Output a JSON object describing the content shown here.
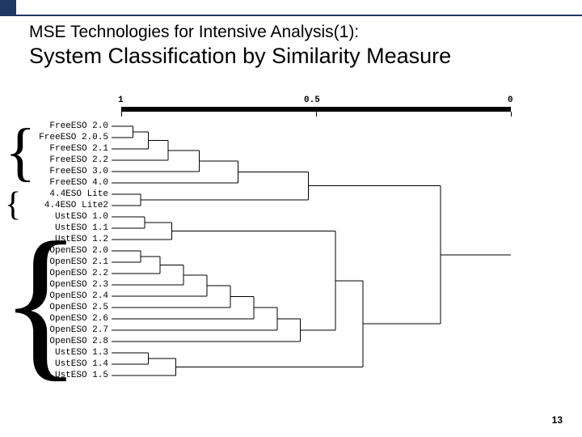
{
  "accent_color": "#1f3864",
  "header": {
    "subtitle": "MSE Technologies for Intensive Analysis(1):",
    "title": "System Classification by Similarity Measure"
  },
  "page_number": "13",
  "dendrogram": {
    "axis_labels": {
      "left": "1",
      "mid": "0.5",
      "right": "0"
    },
    "leaves": [
      "FreeESO 2.0",
      "FreeESO 2.0.5",
      "FreeESO 2.1",
      "FreeESO 2.2",
      "FreeESO 3.0",
      "FreeESO 4.0",
      "4.4ESO Lite",
      "4.4ESO Lite2",
      "UstESO 1.0",
      "UstESO 1.1",
      "UstESO 1.2",
      "OpenESO 2.0",
      "OpenESO 2.1",
      "OpenESO 2.2",
      "OpenESO 2.3",
      "OpenESO 2.4",
      "OpenESO 2.5",
      "OpenESO 2.6",
      "OpenESO 2.7",
      "OpenESO 2.8",
      "UstESO 1.3",
      "UstESO 1.4",
      "UstESO 1.5"
    ]
  },
  "chart_data": {
    "type": "dendrogram",
    "similarity_axis": {
      "left": 1.0,
      "right": 0.0
    },
    "merges": [
      {
        "members": [
          "FreeESO 2.0",
          "FreeESO 2.0.5"
        ],
        "similarity": 0.97
      },
      {
        "members": [
          "(FreeESO 2.0,2.0.5)",
          "FreeESO 2.1"
        ],
        "similarity": 0.93
      },
      {
        "members": [
          "(prev)",
          "FreeESO 2.2"
        ],
        "similarity": 0.88
      },
      {
        "members": [
          "(prev)",
          "FreeESO 3.0"
        ],
        "similarity": 0.8
      },
      {
        "members": [
          "(prev)",
          "FreeESO 4.0"
        ],
        "similarity": 0.7
      },
      {
        "members": [
          "4.4ESO Lite",
          "4.4ESO Lite2"
        ],
        "similarity": 0.95
      },
      {
        "members": [
          "FreeESO cluster",
          "4.4ESO Lite cluster"
        ],
        "similarity": 0.52
      },
      {
        "members": [
          "UstESO 1.0",
          "UstESO 1.1"
        ],
        "similarity": 0.94
      },
      {
        "members": [
          "(prev)",
          "UstESO 1.2"
        ],
        "similarity": 0.87
      },
      {
        "members": [
          "OpenESO 2.0",
          "OpenESO 2.1"
        ],
        "similarity": 0.95
      },
      {
        "members": [
          "(prev)",
          "OpenESO 2.2"
        ],
        "similarity": 0.9
      },
      {
        "members": [
          "(prev)",
          "OpenESO 2.3"
        ],
        "similarity": 0.84
      },
      {
        "members": [
          "(prev)",
          "OpenESO 2.4"
        ],
        "similarity": 0.78
      },
      {
        "members": [
          "(prev)",
          "OpenESO 2.5"
        ],
        "similarity": 0.72
      },
      {
        "members": [
          "(prev)",
          "OpenESO 2.6"
        ],
        "similarity": 0.66
      },
      {
        "members": [
          "(prev)",
          "OpenESO 2.7"
        ],
        "similarity": 0.6
      },
      {
        "members": [
          "(prev)",
          "OpenESO 2.8"
        ],
        "similarity": 0.54
      },
      {
        "members": [
          "UstESO 1.3",
          "UstESO 1.4"
        ],
        "similarity": 0.93
      },
      {
        "members": [
          "(prev)",
          "UstESO 1.5"
        ],
        "similarity": 0.86
      },
      {
        "members": [
          "UstESO 1.x early",
          "OpenESO cluster"
        ],
        "similarity": 0.45
      },
      {
        "members": [
          "(prev)",
          "UstESO 1.3-1.5"
        ],
        "similarity": 0.38
      },
      {
        "members": [
          "Free/4.4 cluster",
          "Ust/Open cluster"
        ],
        "similarity": 0.18
      }
    ]
  }
}
